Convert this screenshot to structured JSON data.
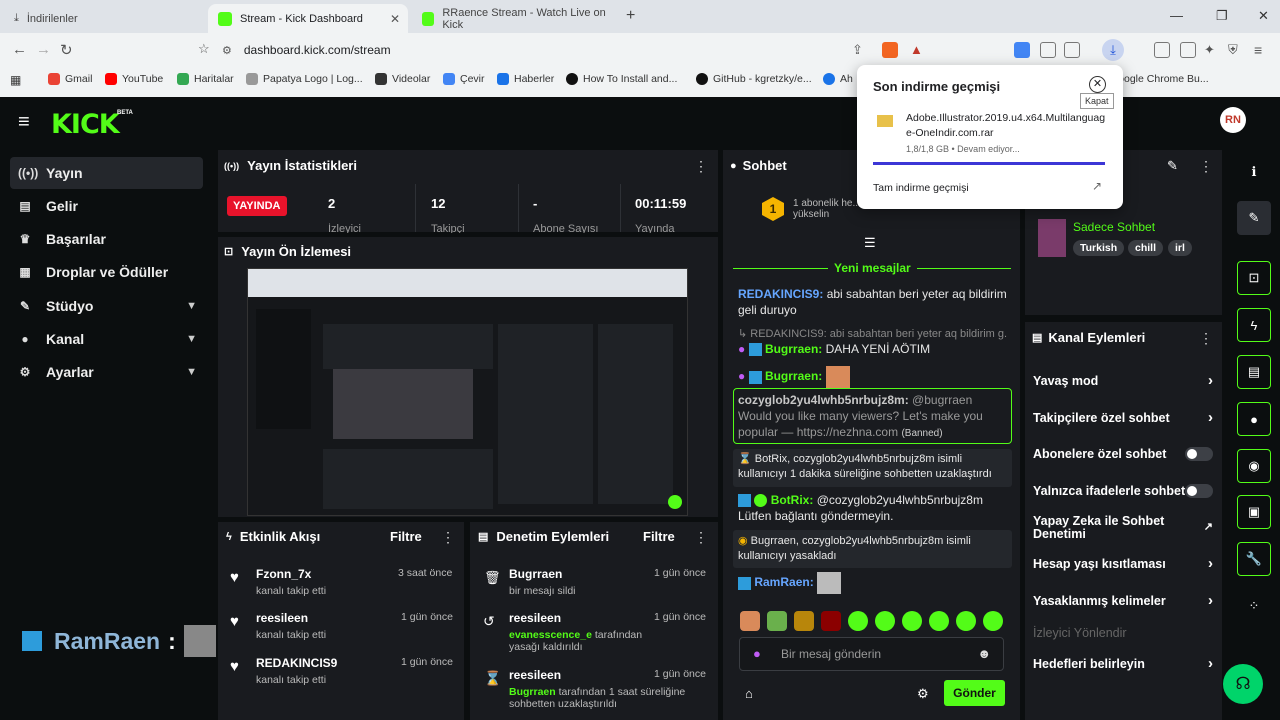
{
  "browser": {
    "tabs": [
      {
        "label": "İndirilenler"
      },
      {
        "label": "Stream - Kick Dashboard"
      },
      {
        "label": "RRaence Stream - Watch Live on Kick"
      }
    ],
    "url": "dashboard.kick.com/stream",
    "bookmarks": [
      "Gmail",
      "YouTube",
      "Haritalar",
      "Papatya Logo | Log...",
      "Videolar",
      "Çevir",
      "Haberler",
      "How To Install and...",
      "GitHub - kgretzky/e...",
      "Ah",
      "Google Chrome Bu..."
    ]
  },
  "download_popup": {
    "title": "Son indirme geçmişi",
    "close_tooltip": "Kapat",
    "file_name": "Adobe.Illustrator.2019.u4.x64.Multilanguage-OneIndir.com.rar",
    "file_status": "1,8/1,8 GB • Devam ediyor...",
    "progress": 1.0,
    "history_link": "Tam indirme geçmişi"
  },
  "header": {
    "logo": "KICK",
    "logo_badge": "BETA",
    "avatar": "RN"
  },
  "sidebar": {
    "items": [
      {
        "label": "Yayın",
        "icon": "broadcast-icon"
      },
      {
        "label": "Gelir",
        "icon": "chart-icon"
      },
      {
        "label": "Başarılar",
        "icon": "trophy-icon"
      },
      {
        "label": "Droplar ve Ödüller",
        "icon": "gift-icon"
      },
      {
        "label": "Stüdyo",
        "icon": "pencil-icon"
      },
      {
        "label": "Kanal",
        "icon": "user-icon"
      },
      {
        "label": "Ayarlar",
        "icon": "gear-icon"
      }
    ]
  },
  "stats": {
    "title": "Yayın İstatistikleri",
    "live_badge": "YAYINDA",
    "items": [
      {
        "value": "2",
        "label": "İzleyici"
      },
      {
        "value": "12",
        "label": "Takipçi"
      },
      {
        "value": "-",
        "label": "Abone Sayısı"
      },
      {
        "value": "00:11:59",
        "label": "Yayında"
      }
    ]
  },
  "preview": {
    "title": "Yayın Ön İzlemesi"
  },
  "activity": {
    "title": "Etkinlik Akışı",
    "filter": "Filtre",
    "rows": [
      {
        "name": "Fzonn_7x",
        "sub": "kanalı takip etti",
        "time": "3 saat önce"
      },
      {
        "name": "reesileen",
        "sub": "kanalı takip etti",
        "time": "1 gün önce"
      },
      {
        "name": "REDAKINCIS9",
        "sub": "kanalı takip etti",
        "time": "1 gün önce"
      }
    ]
  },
  "moderation": {
    "title": "Denetim Eylemleri",
    "filter": "Filtre",
    "rows": [
      {
        "name": "Bugrraen",
        "sub": "bir mesajı sildi",
        "time": "1 gün önce"
      },
      {
        "name": "reesileen",
        "sub_user": "evanesscence_e",
        "sub": "tarafından yasağı kaldırıldı",
        "time": "1 gün önce"
      },
      {
        "name": "reesileen",
        "sub_user": "Bugrraen",
        "sub": "tarafından 1 saat süreliğine sohbetten uzaklaştırıldı",
        "time": "1 gün önce"
      }
    ]
  },
  "chat": {
    "title": "Sohbet",
    "sub_goal": "1 abonelik he... yükselin",
    "new_messages": "Yeni mesajlar",
    "m1_user": "REDAKINCIS9:",
    "m1_text": "abi sabahtan beri yeter aq bildirim geli duruyo",
    "m2_reply": "REDAKINCIS9: abi sabahtan beri yeter aq bildirim g...",
    "m2_user": "Bugrraen:",
    "m2_text": "DAHA YENİ AÖTIM",
    "m3_user": "Bugrraen:",
    "m4_user": "cozyglob2yu4lwhb5nrbujz8m:",
    "m4_text": "@bugrraen Would you like many viewers? Let's make you popular — https://nezhna.com",
    "m4_banned": "(Banned)",
    "m5_text": "BotRix, cozyglob2yu4lwhb5nrbujz8m isimli kullanıcıyı 1 dakika süreliğine sohbetten uzaklaştırdı",
    "m6_user": "BotRix:",
    "m6_text": "@cozyglob2yu4lwhb5nrbujz8m Lütfen bağlantı göndermeyin.",
    "m7_text": "Bugrraen, cozyglob2yu4lwhb5nrbujz8m isimli kullanıcıyı yasakladı",
    "m8_user": "RamRaen:",
    "input_placeholder": "Bir mesaj gönderin",
    "send": "Gönder"
  },
  "stream_info": {
    "mode": "Sadece Sohbet",
    "tags": [
      "Turkish",
      "chill",
      "irl"
    ]
  },
  "channel_actions": {
    "title": "Kanal Eylemleri",
    "items": [
      {
        "label": "Yavaş mod",
        "type": "arrow"
      },
      {
        "label": "Takipçilere özel sohbet",
        "type": "arrow"
      },
      {
        "label": "Abonelere özel sohbet",
        "type": "toggle"
      },
      {
        "label": "Yalnızca ifadelerle sohbet",
        "type": "toggle"
      },
      {
        "label": "Yapay Zeka ile Sohbet Denetimi",
        "type": "external"
      },
      {
        "label": "Hesap yaşı kısıtlaması",
        "type": "arrow"
      },
      {
        "label": "Yasaklanmış kelimeler",
        "type": "arrow"
      }
    ],
    "disabled_label": "İzleyici Yönlendir",
    "last_label": "Hedefleri belirleyin"
  },
  "overlay": {
    "name": "RamRaen",
    "colon": ":"
  },
  "colors": {
    "accent": "#53fc18",
    "live": "#e8132b",
    "panel": "#191b1f"
  }
}
